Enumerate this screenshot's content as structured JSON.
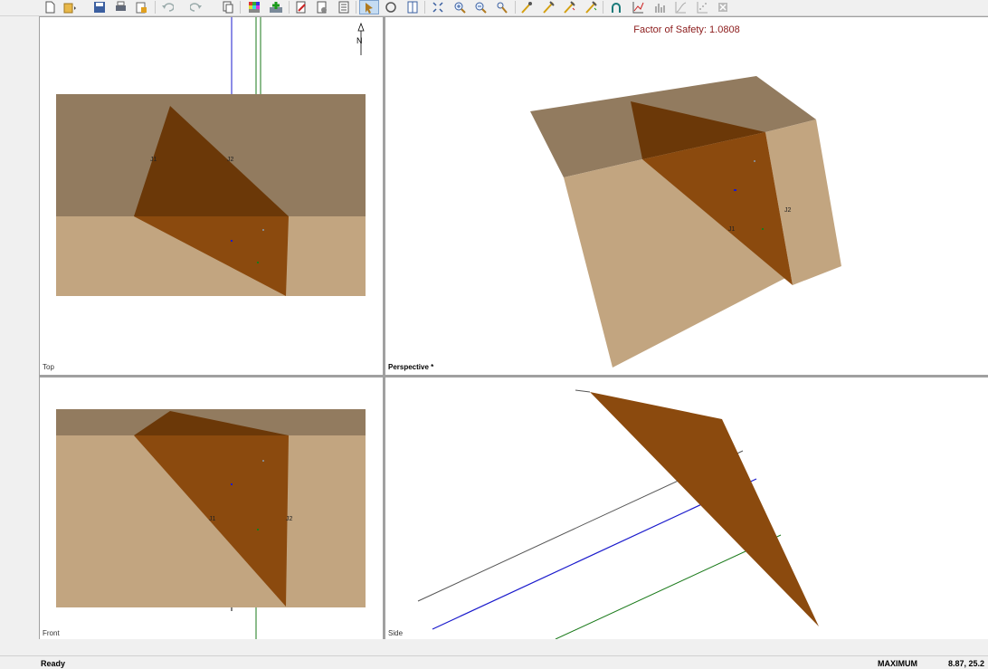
{
  "toolbar": {
    "buttons": [
      {
        "icon": "new-file-icon"
      },
      {
        "icon": "open-folder-icon"
      },
      {
        "icon": "save-icon"
      },
      {
        "icon": "print-icon"
      },
      {
        "icon": "export-icon"
      },
      {
        "icon": "undo-icon"
      },
      {
        "icon": "redo-icon"
      },
      {
        "icon": "copy-icon"
      },
      {
        "icon": "display-options-icon"
      },
      {
        "icon": "add-joint-icon"
      },
      {
        "icon": "edit-joint-icon"
      },
      {
        "icon": "compute-icon"
      },
      {
        "icon": "select-icon"
      },
      {
        "icon": "rotate-icon"
      },
      {
        "icon": "viewports-icon"
      },
      {
        "icon": "zoom-extents-icon"
      },
      {
        "icon": "zoom-in-icon"
      },
      {
        "icon": "zoom-out-icon"
      },
      {
        "icon": "pan-icon"
      },
      {
        "icon": "bolt-icon"
      },
      {
        "icon": "shotcrete-icon"
      },
      {
        "icon": "pressure-icon"
      },
      {
        "icon": "force-icon"
      },
      {
        "icon": "stereonet-icon"
      },
      {
        "icon": "graph-icon"
      },
      {
        "icon": "histogram-icon"
      },
      {
        "icon": "cumulative-icon"
      },
      {
        "icon": "scatter-icon"
      },
      {
        "icon": "excel-icon"
      }
    ]
  },
  "viewports": {
    "top": {
      "label": "Top"
    },
    "perspective": {
      "label": "Perspective *",
      "fos_prefix": "Factor of Safety:",
      "fos_value": "1.0808"
    },
    "front": {
      "label": "Front"
    },
    "side": {
      "label": "Side"
    }
  },
  "labels": {
    "joint1": "J1",
    "joint2": "J2",
    "north": "N"
  },
  "colors": {
    "upper_face": "#927b5f",
    "slope_face": "#c2a580",
    "wedge_face": "#8b4a0e",
    "wedge_upper": "#6b3808",
    "fos_text": "#8b1a1a"
  },
  "status": {
    "ready": "Ready",
    "mode": "MAXIMUM",
    "coords": "8.87, 25.2"
  }
}
